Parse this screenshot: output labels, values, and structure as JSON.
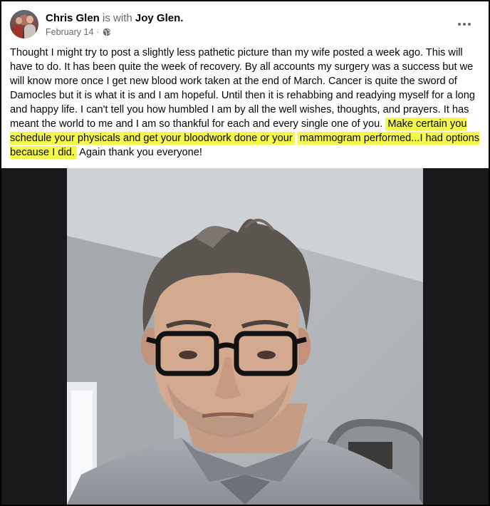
{
  "post": {
    "author": "Chris Glen",
    "with_text": "is with",
    "tagged": "Joy Glen",
    "tagged_suffix": ".",
    "date": "February 14",
    "date_separator": "·",
    "privacy_icon": "globe-icon",
    "more_icon": "more-horizontal-icon",
    "body_plain": "Thought I might try to post a slightly less pathetic picture than my wife posted a week ago.  This will have to do.  It has been quite the week of recovery.  By all accounts my surgery was a success but we will know more once I get new blood work taken at the end of March.  Cancer is quite the sword of Damocles but it is what it is and I am hopeful.  Until then it is rehabbing and readying myself for a long and happy life.  I can't tell you how humbled I am by all the well wishes, thoughts, and prayers.  It has meant the world to me and I am so thankful for each and every single one of you.",
    "body_highlighted_1": "Make certain you schedule your physicals and get your bloodwork done or your",
    "body_highlighted_2": "mammogram performed...I had options because I did.",
    "body_end": "Again thank you everyone!",
    "highlight_color": "#f3f84a"
  }
}
